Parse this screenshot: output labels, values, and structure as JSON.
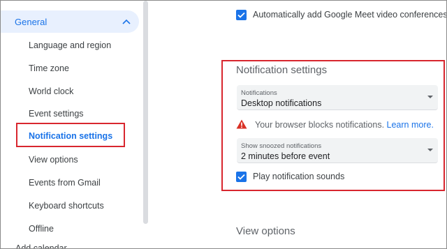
{
  "sidebar": {
    "general_label": "General",
    "items": [
      {
        "label": "Language and region"
      },
      {
        "label": "Time zone"
      },
      {
        "label": "World clock"
      },
      {
        "label": "Event settings"
      },
      {
        "label": "Notification settings"
      },
      {
        "label": "View options"
      },
      {
        "label": "Events from Gmail"
      },
      {
        "label": "Keyboard shortcuts"
      },
      {
        "label": "Offline"
      }
    ],
    "cut_item_label": "Add calendar"
  },
  "main": {
    "meet_checkbox_label": "Automatically add Google Meet video conferences to e",
    "notification_section": {
      "title": "Notification settings",
      "notifications_select": {
        "caption": "Notifications",
        "value": "Desktop notifications"
      },
      "warning_text": "Your browser blocks notifications.",
      "learn_more": "Learn more.",
      "snoozed_select": {
        "caption": "Show snoozed notifications",
        "value": "2 minutes before event"
      },
      "sounds_checkbox_label": "Play notification sounds"
    },
    "view_options_title": "View options"
  },
  "colors": {
    "accent": "#1a73e8",
    "highlight_box": "#d8262e",
    "warning": "#d93025"
  }
}
